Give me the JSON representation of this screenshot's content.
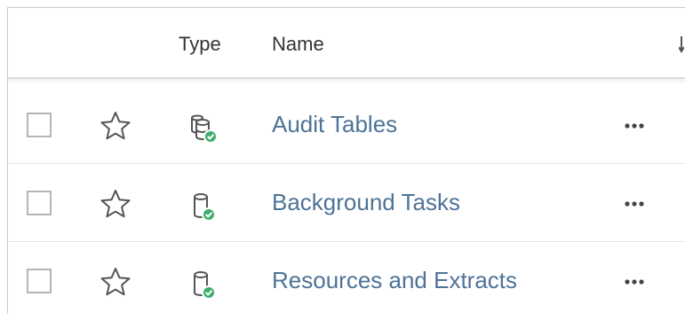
{
  "header": {
    "type_label": "Type",
    "name_label": "Name"
  },
  "rows": [
    {
      "name": "Audit Tables",
      "type_icon": "multi-database-certified-icon",
      "favorite": false,
      "selected": false
    },
    {
      "name": "Background Tasks",
      "type_icon": "database-certified-icon",
      "favorite": false,
      "selected": false
    },
    {
      "name": "Resources and Extracts",
      "type_icon": "database-certified-icon",
      "favorite": false,
      "selected": false
    }
  ],
  "colors": {
    "link": "#4e7397",
    "certified_badge": "#3fae6b",
    "icon_stroke": "#555555",
    "divider": "#e3e3e3"
  }
}
